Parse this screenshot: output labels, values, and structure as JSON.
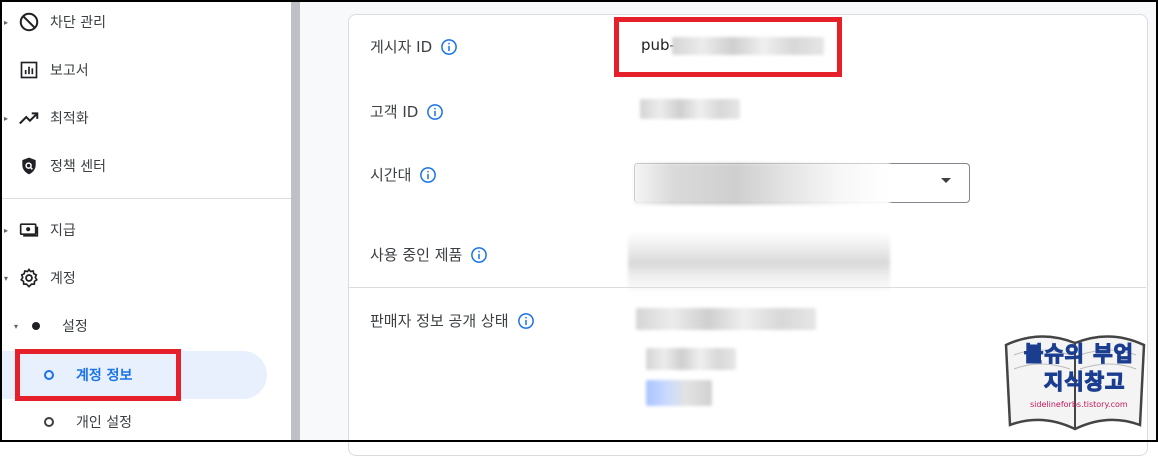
{
  "sidebar": {
    "items": [
      {
        "label": "차단 관리",
        "icon": "block-icon"
      },
      {
        "label": "보고서",
        "icon": "report-chart-icon"
      },
      {
        "label": "최적화",
        "icon": "trending-up-icon"
      },
      {
        "label": "정책 센터",
        "icon": "policy-shield-icon"
      },
      {
        "label": "지급",
        "icon": "payments-icon"
      },
      {
        "label": "계정",
        "icon": "gear-icon"
      }
    ],
    "settings_label": "설정",
    "account_info_label": "계정 정보",
    "personal_settings_label": "개인 설정"
  },
  "main": {
    "publisher_id_label": "게시자 ID",
    "publisher_id_value": "pub-",
    "customer_id_label": "고객 ID",
    "timezone_label": "시간대",
    "products_label": "사용 중인 제품",
    "seller_info_label": "판매자 정보 공개 상태"
  },
  "watermark": {
    "line1": "블슈의 부업",
    "line2": "지식창고",
    "url": "sidelineforbs.tistory.com"
  },
  "colors": {
    "accent": "#1a73e8",
    "highlight_red": "#e5202a",
    "active_bg": "#e8f0fe"
  }
}
